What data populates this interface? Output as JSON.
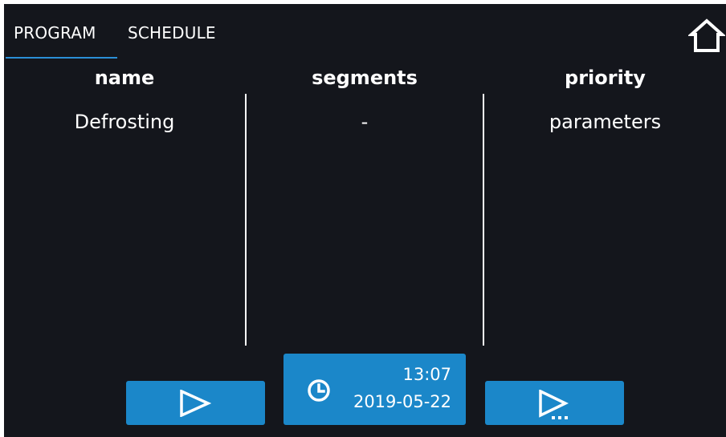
{
  "tabs": {
    "program_label": "PROGRAM",
    "schedule_label": "SCHEDULE",
    "active": "PROGRAM"
  },
  "table": {
    "headers": {
      "name": "name",
      "segments": "segments",
      "priority": "priority"
    },
    "rows": [
      {
        "name": "Defrosting",
        "segments": "-",
        "priority": "parameters"
      }
    ]
  },
  "clock": {
    "time": "13:07",
    "date": "2019-05-22"
  },
  "icons": {
    "home": "home-icon",
    "start": "play-icon",
    "clock": "clock-icon",
    "start_options": "play-options-icon"
  },
  "colors": {
    "background": "#14161c",
    "accent": "#1b87c9",
    "tab_underline": "#2b8fd6",
    "text": "#ffffff"
  }
}
